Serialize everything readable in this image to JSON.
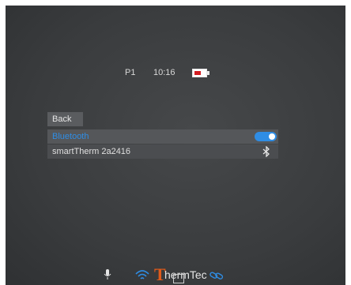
{
  "status": {
    "preset": "P1",
    "time": "10:16",
    "battery_icon": "battery-low-icon",
    "battery_color": "#d21d22"
  },
  "menu": {
    "back_label": "Back",
    "bluetooth_label": "Bluetooth",
    "bluetooth_enabled": true,
    "device_name": "smartTherm  2a2416",
    "accent": "#2f8de4"
  },
  "bottom_bar": {
    "icons": [
      "microphone-icon",
      "wifi-icon",
      "record-icon",
      "link-icon"
    ],
    "logo": "ThermTec",
    "logo_color": "#e05a1a"
  }
}
